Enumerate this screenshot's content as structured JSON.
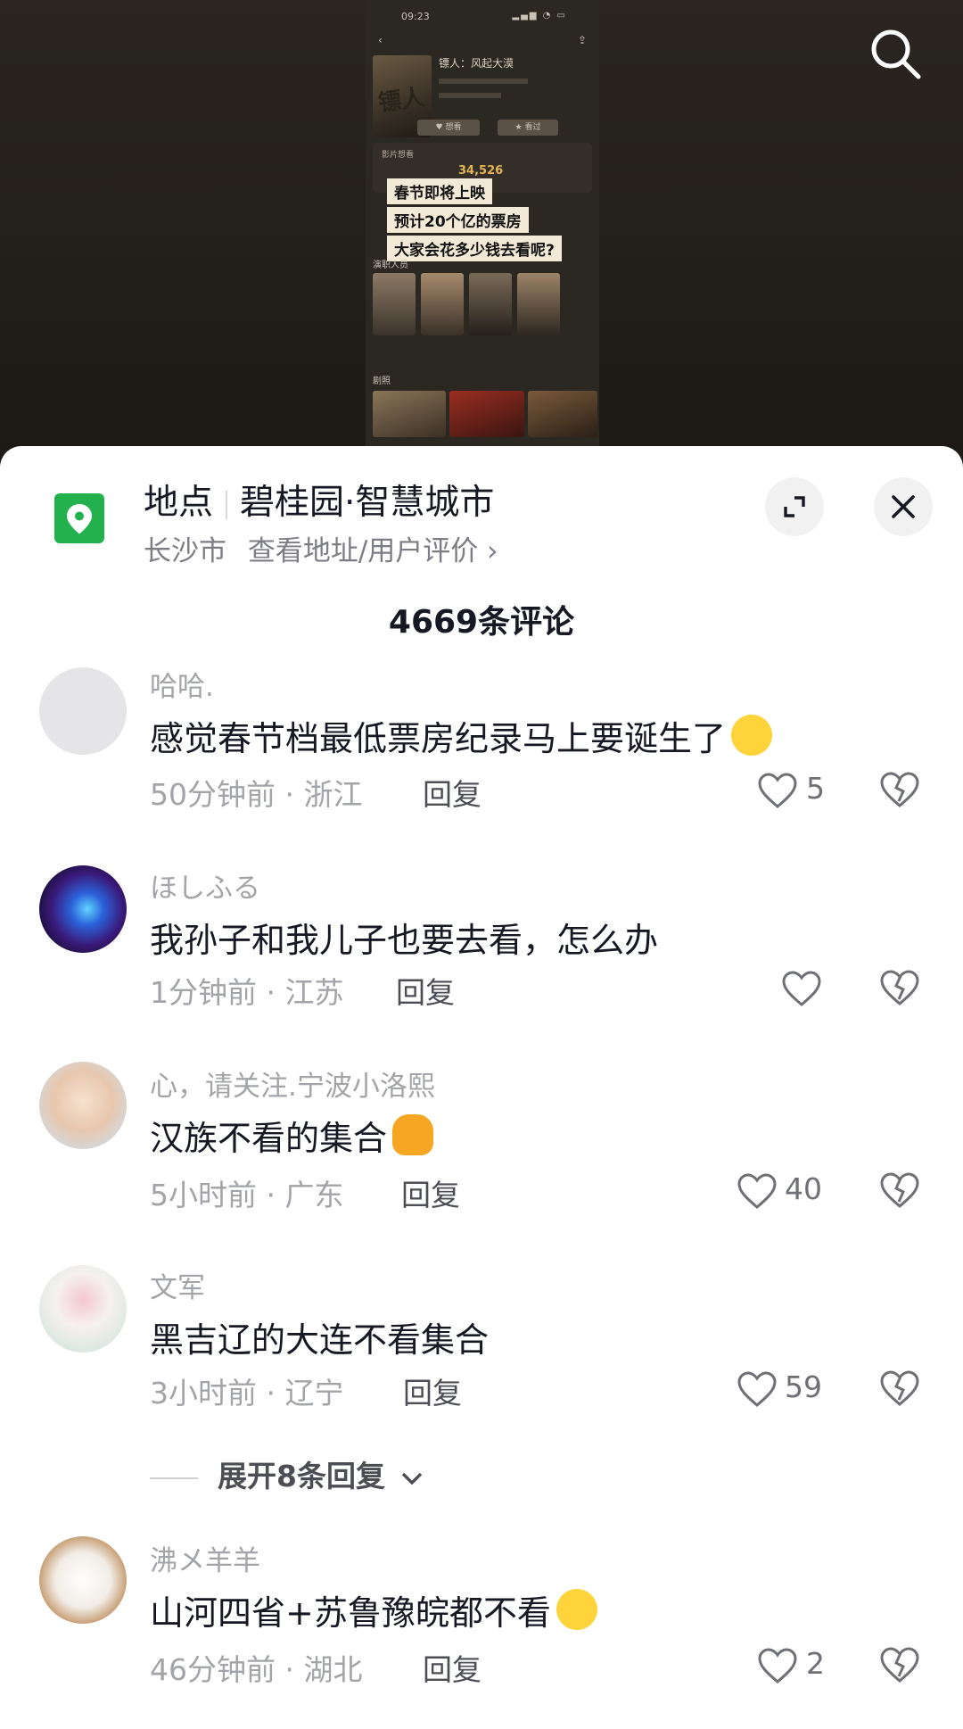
{
  "video": {
    "status_time": "09:23",
    "movie_title": "镖人：风起大漠",
    "want_count": "34,526",
    "captions": [
      "春节即将上映",
      "预计20个亿的票房",
      "大家会花多少钱去看呢?"
    ],
    "section_cast": "演职人员",
    "section_stills": "剧照",
    "want_label": "影片想看",
    "btn_want": "想看",
    "btn_rate": "看过"
  },
  "location": {
    "label": "地点",
    "name": "碧桂园·智慧城市",
    "city": "长沙市",
    "link": "查看地址/用户评价"
  },
  "comments_header": "4669条评论",
  "comments": [
    {
      "user": "哈哈.",
      "text": "感觉春节档最低票房纪录马上要诞生了",
      "time": "50分钟前",
      "region": "浙江",
      "reply": "回复",
      "likes": "5"
    },
    {
      "user": "ほしふる",
      "text": "我孙子和我儿子也要去看，怎么办",
      "time": "1分钟前",
      "region": "江苏",
      "reply": "回复",
      "likes": ""
    },
    {
      "user": "心，请关注.宁波小洛熙",
      "text": "汉族不看的集合",
      "time": "5小时前",
      "region": "广东",
      "reply": "回复",
      "likes": "40"
    },
    {
      "user": "文军",
      "text": "黑吉辽的大连不看集合",
      "time": "3小时前",
      "region": "辽宁",
      "reply": "回复",
      "likes": "59"
    },
    {
      "user": "沸メ羊羊",
      "text": "山河四省+苏鲁豫皖都不看",
      "time": "46分钟前",
      "region": "湖北",
      "reply": "回复",
      "likes": "2"
    }
  ],
  "expand_replies": "展开8条回复",
  "separator": " · "
}
